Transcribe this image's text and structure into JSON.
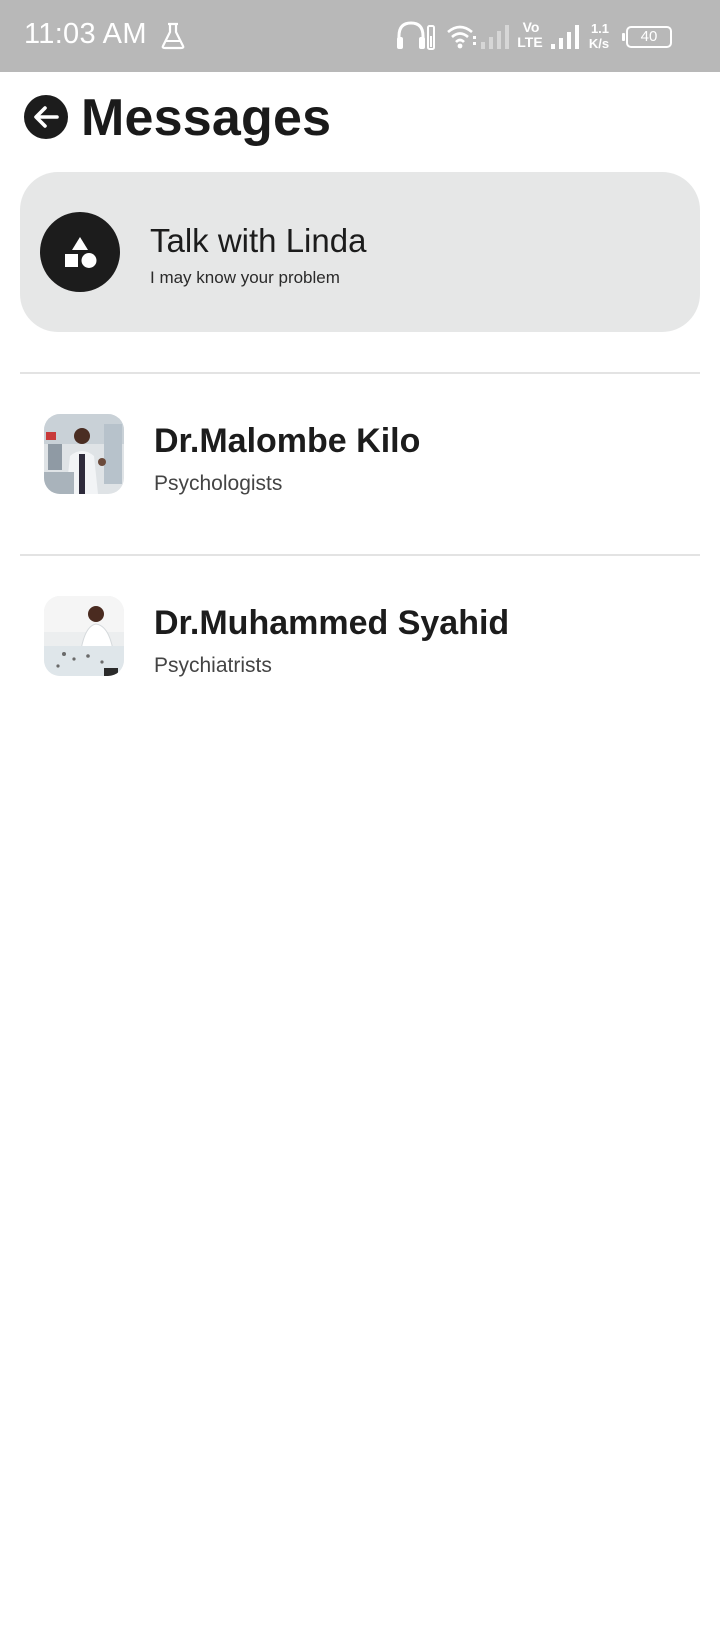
{
  "status_bar": {
    "time": "11:03 AM",
    "volte_top": "Vo",
    "volte_bottom": "LTE",
    "speed_top": "1.1",
    "speed_bottom": "K/s",
    "battery": "40"
  },
  "header": {
    "title": "Messages"
  },
  "assistant_card": {
    "name": "Talk with Linda",
    "subtitle": "I may know your problem"
  },
  "doctors": [
    {
      "name": "Dr.Malombe Kilo",
      "specialty": "Psychologists"
    },
    {
      "name": "Dr.Muhammed Syahid",
      "specialty": "Psychiatrists"
    }
  ],
  "colors": {
    "status_bar_bg": "#b8b8b8",
    "card_bg": "#e6e7e7",
    "dark": "#1c1c1c",
    "divider": "#e3e3e3"
  }
}
